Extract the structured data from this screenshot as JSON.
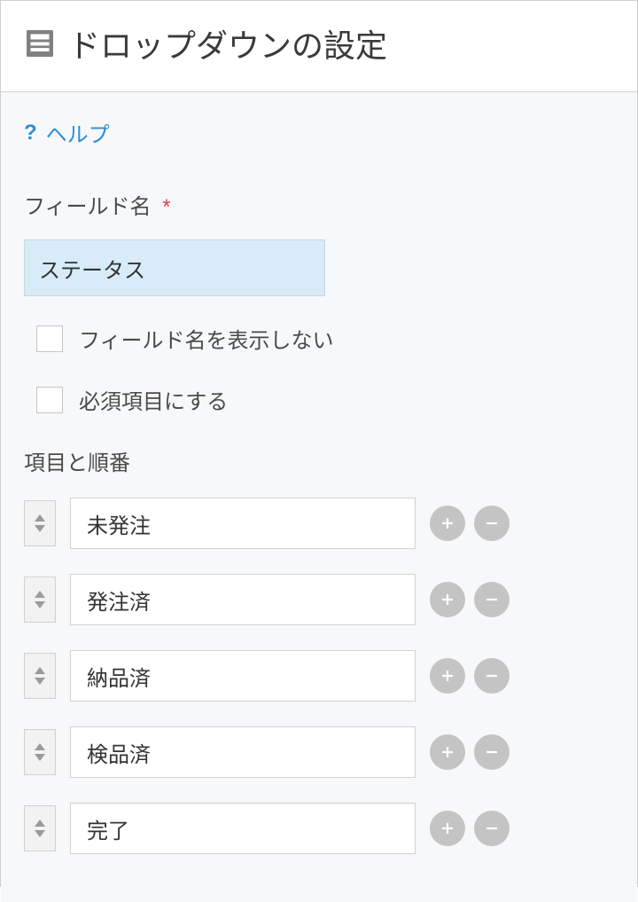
{
  "header": {
    "title": "ドロップダウンの設定"
  },
  "help": {
    "label": "ヘルプ"
  },
  "field": {
    "label": "フィールド名",
    "required_mark": "*",
    "value": "ステータス",
    "hide_name_label": "フィールド名を表示しない",
    "required_label": "必須項目にする"
  },
  "items": {
    "label": "項目と順番",
    "list": [
      {
        "value": "未発注"
      },
      {
        "value": "発注済"
      },
      {
        "value": "納品済"
      },
      {
        "value": "検品済"
      },
      {
        "value": "完了"
      }
    ]
  }
}
